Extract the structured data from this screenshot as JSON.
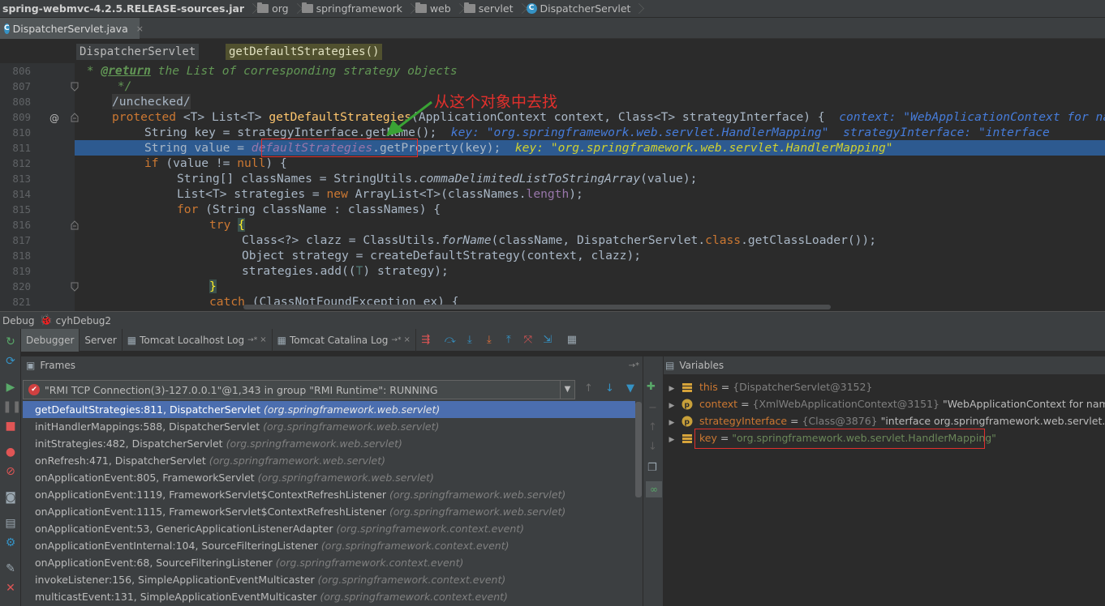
{
  "breadcrumb": {
    "items": [
      "spring-webmvc-4.2.5.RELEASE-sources.jar",
      "org",
      "springframework",
      "web",
      "servlet",
      "DispatcherServlet"
    ]
  },
  "editor_tab": {
    "label": "DispatcherServlet.java",
    "close": "×"
  },
  "structure": {
    "class_name": "DispatcherServlet",
    "method_name": "getDefaultStrategies()"
  },
  "code": {
    "line_numbers": [
      "806",
      "807",
      "808",
      "809",
      "810",
      "811",
      "812",
      "813",
      "814",
      "815",
      "816",
      "817",
      "818",
      "819",
      "820",
      "821"
    ],
    "l806_a": " * ",
    "l806_tag": "@return",
    "l806_b": " the List of corresponding strategy objects",
    "l807": " */",
    "l808": "/unchecked/",
    "l809_kw": "protected",
    "l809_a": " <T> List<T> ",
    "l809_fn": "getDefaultStrategies",
    "l809_b": "(ApplicationContext context, Class<T> strategyInterface) {",
    "l809_hint": "  context: \"WebApplicationContext for namespace",
    "l810_a": "String key = strategyInterface.getName();",
    "l810_hint": "  key: \"org.springframework.web.servlet.HandlerMapping\"  strategyInterface: \"interface",
    "l811_a": "String value = ",
    "l811_fld": "defaultStrategies",
    "l811_b": ".getProperty(key);",
    "l811_hint": "  key: \"org.springframework.web.servlet.HandlerMapping\"",
    "l812_kw": "if",
    "l812_a": " (value != ",
    "l812_kw2": "null",
    "l812_b": ") {",
    "l813_a": "String[] classNames = StringUtils.",
    "l813_it": "commaDelimitedListToStringArray",
    "l813_b": "(value);",
    "l814_a": "List<T> strategies = ",
    "l814_kw": "new",
    "l814_b": " ArrayList<T>(classNames.",
    "l814_fld": "length",
    "l814_c": ");",
    "l815_kw": "for",
    "l815_a": " (String className : classNames) {",
    "l816_kw": "try",
    "l816_brace": "{",
    "l817_a": "Class<?> clazz = ClassUtils.",
    "l817_it": "forName",
    "l817_b": "(className, DispatcherServlet.",
    "l817_kw": "class",
    "l817_c": ".getClassLoader());",
    "l818_a": "Object strategy = createDefaultStrategy(context, clazz);",
    "l819_a": "strategies.add((",
    "l819_t": "T",
    "l819_b": ") strategy);",
    "l820_brace": "}",
    "l821_kw": "catch",
    "l821_a": " (ClassNotFoundException ex) {"
  },
  "annotation": {
    "text": "从这个对象中去找"
  },
  "debug": {
    "title": "Debug",
    "config": "cyhDebug2",
    "tabs": [
      {
        "label": "Debugger"
      },
      {
        "label": "Server"
      },
      {
        "label": "Tomcat Localhost Log"
      },
      {
        "label": "Tomcat Catalina Log"
      }
    ],
    "pin": "→*",
    "close": "×"
  },
  "frames": {
    "header": "Frames",
    "thread": "\"RMI TCP Connection(3)-127.0.0.1\"@1,343 in group \"RMI Runtime\": RUNNING",
    "items": [
      {
        "method": "getDefaultStrategies:811, DispatcherServlet",
        "pkg": "(org.springframework.web.servlet)"
      },
      {
        "method": "initHandlerMappings:588, DispatcherServlet",
        "pkg": "(org.springframework.web.servlet)"
      },
      {
        "method": "initStrategies:482, DispatcherServlet",
        "pkg": "(org.springframework.web.servlet)"
      },
      {
        "method": "onRefresh:471, DispatcherServlet",
        "pkg": "(org.springframework.web.servlet)"
      },
      {
        "method": "onApplicationEvent:805, FrameworkServlet",
        "pkg": "(org.springframework.web.servlet)"
      },
      {
        "method": "onApplicationEvent:1119, FrameworkServlet$ContextRefreshListener",
        "pkg": "(org.springframework.web.servlet)"
      },
      {
        "method": "onApplicationEvent:1115, FrameworkServlet$ContextRefreshListener",
        "pkg": "(org.springframework.web.servlet)"
      },
      {
        "method": "onApplicationEvent:53, GenericApplicationListenerAdapter",
        "pkg": "(org.springframework.context.event)"
      },
      {
        "method": "onApplicationEventInternal:104, SourceFilteringListener",
        "pkg": "(org.springframework.context.event)"
      },
      {
        "method": "onApplicationEvent:68, SourceFilteringListener",
        "pkg": "(org.springframework.context.event)"
      },
      {
        "method": "invokeListener:156, SimpleApplicationEventMulticaster",
        "pkg": "(org.springframework.context.event)"
      },
      {
        "method": "multicastEvent:131, SimpleApplicationEventMulticaster",
        "pkg": "(org.springframework.context.event)"
      }
    ]
  },
  "variables": {
    "header": "Variables",
    "items": [
      {
        "name": "this",
        "eq": " = ",
        "type": "{DispatcherServlet@3152}",
        "val": ""
      },
      {
        "name": "context",
        "eq": " = ",
        "type": "{XmlWebApplicationContext@3151}",
        "val": " \"WebApplicationContext for namespace"
      },
      {
        "name": "strategyInterface",
        "eq": " = ",
        "type": "{Class@3876}",
        "val": " \"interface org.springframework.web.servlet.HandlerM"
      },
      {
        "name": "key",
        "eq": " = ",
        "type": "",
        "val": "\"org.springframework.web.servlet.HandlerMapping\""
      }
    ]
  }
}
